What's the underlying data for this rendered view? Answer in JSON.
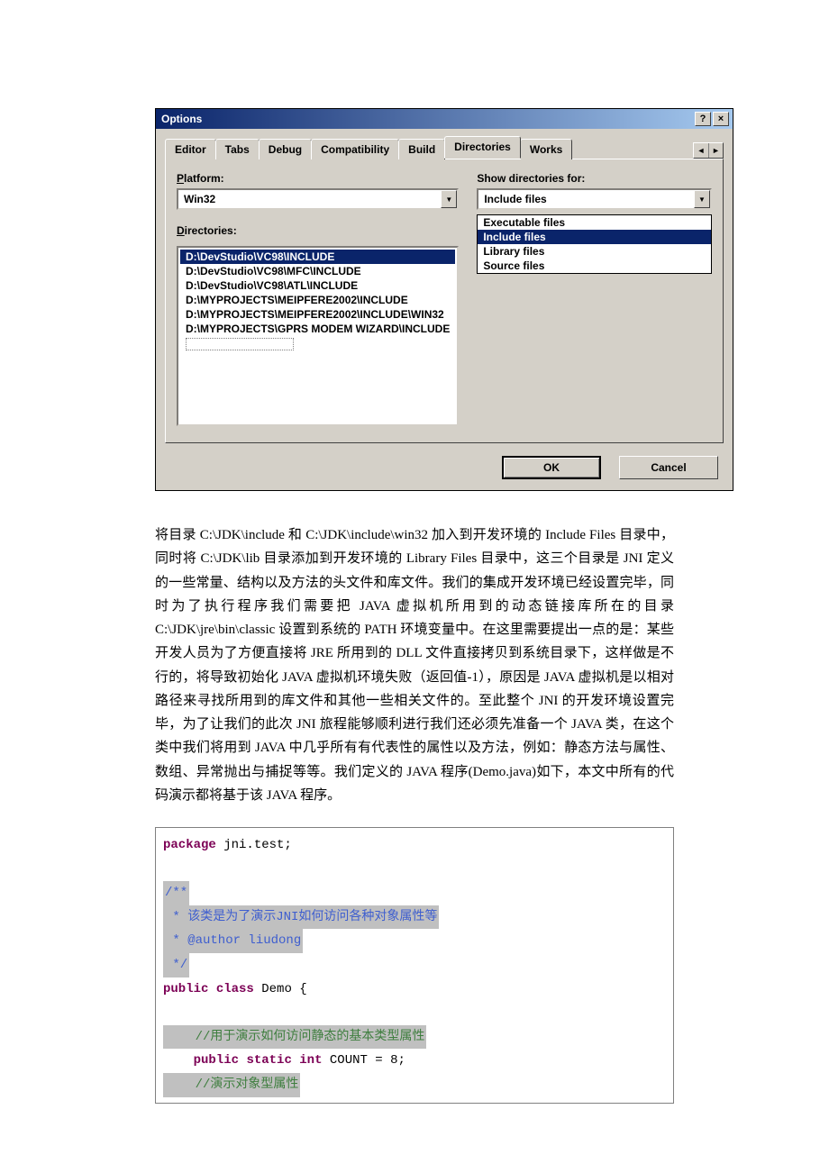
{
  "dialog": {
    "title": "Options",
    "help_btn": "?",
    "close_btn": "×",
    "tabs": [
      "Editor",
      "Tabs",
      "Debug",
      "Compatibility",
      "Build",
      "Directories",
      "Works"
    ],
    "active_tab": 5,
    "scroll_left": "◄",
    "scroll_right": "►",
    "platform_label": "Platform:",
    "platform_value": "Win32",
    "showdir_label": "Show directories for:",
    "showdir_value": "Include files",
    "showdir_options": [
      "Executable files",
      "Include files",
      "Library files",
      "Source files"
    ],
    "showdir_selected": 1,
    "directories_label": "Directories:",
    "directories": [
      "D:\\DevStudio\\VC98\\INCLUDE",
      "D:\\DevStudio\\VC98\\MFC\\INCLUDE",
      "D:\\DevStudio\\VC98\\ATL\\INCLUDE",
      "D:\\MYPROJECTS\\MEIPFERE2002\\INCLUDE",
      "D:\\MYPROJECTS\\MEIPFERE2002\\INCLUDE\\WIN32",
      "D:\\MYPROJECTS\\GPRS MODEM WIZARD\\INCLUDE"
    ],
    "directories_selected": 0,
    "ok": "OK",
    "cancel": "Cancel",
    "dropdown_arrow": "▼"
  },
  "article": {
    "text": "将目录 C:\\JDK\\include 和 C:\\JDK\\include\\win32 加入到开发环境的 Include Files 目录中，同时将 C:\\JDK\\lib 目录添加到开发环境的 Library Files 目录中，这三个目录是 JNI 定义的一些常量、结构以及方法的头文件和库文件。我们的集成开发环境已经设置完毕，同时为了执行程序我们需要把 JAVA 虚拟机所用到的动态链接库所在的目录 C:\\JDK\\jre\\bin\\classic 设置到系统的 PATH 环境变量中。在这里需要提出一点的是：某些开发人员为了方便直接将 JRE 所用到的 DLL 文件直接拷贝到系统目录下，这样做是不行的，将导致初始化 JAVA 虚拟机环境失败（返回值-1），原因是 JAVA 虚拟机是以相对路径来寻找所用到的库文件和其他一些相关文件的。至此整个 JNI 的开发环境设置完毕，为了让我们的此次 JNI 旅程能够顺利进行我们还必须先准备一个 JAVA 类，在这个类中我们将用到 JAVA 中几乎所有有代表性的属性以及方法，例如：静态方法与属性、数组、异常抛出与捕捉等等。我们定义的 JAVA 程序(Demo.java)如下，本文中所有的代码演示都将基于该 JAVA 程序。"
  },
  "code": {
    "l1_kw": "package",
    "l1_rest": " jni.test;",
    "l2": "/**",
    "l3": " * 该类是为了演示JNI如何访问各种对象属性等",
    "l4": " * @author liudong",
    "l5": " */",
    "l6_kw1": "public",
    "l6_kw2": "class",
    "l6_rest": " Demo {",
    "l7": "    //用于演示如何访问静态的基本类型属性",
    "l8_pre": "    ",
    "l8_kw1": "public",
    "l8_kw2": "static",
    "l8_kw3": "int",
    "l8_rest": " COUNT = 8;",
    "l9": "    //演示对象型属性"
  }
}
